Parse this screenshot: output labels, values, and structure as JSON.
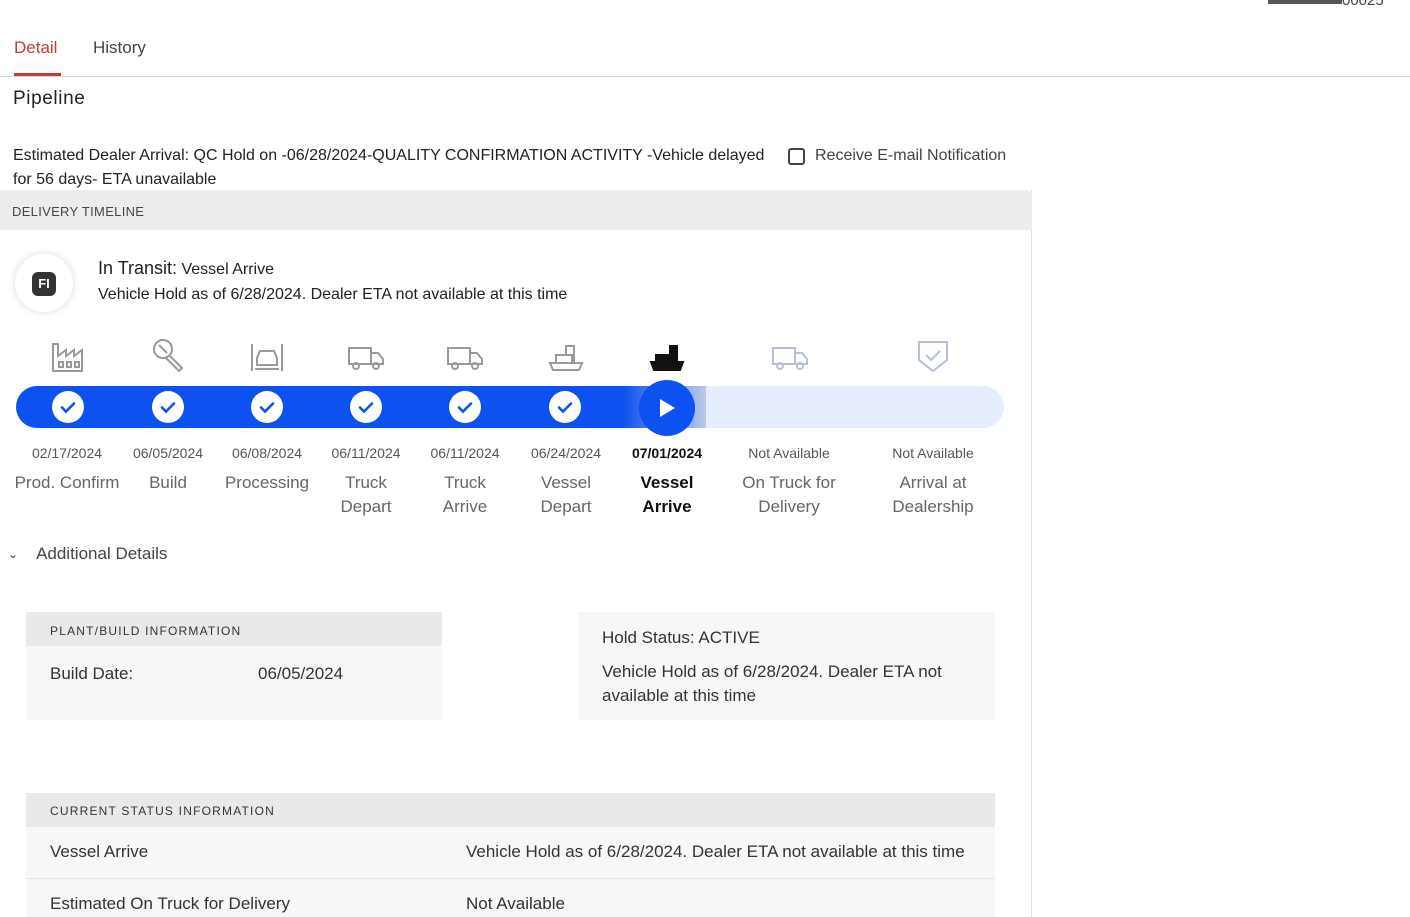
{
  "top": {
    "partial_text": "00025"
  },
  "tabs": [
    {
      "label": "Detail",
      "active": true
    },
    {
      "label": "History",
      "active": false
    }
  ],
  "section_title": "Pipeline",
  "eta": {
    "text": "Estimated Dealer Arrival: QC Hold on -06/28/2024-QUALITY CONFIRMATION ACTIVITY -Vehicle delayed for 56 days- ETA unavailable",
    "notify_label": "Receive E-mail Notification",
    "notify_checked": false
  },
  "timeline": {
    "header": "DELIVERY TIMELINE",
    "badge_text": "FI",
    "transit_label": "In Transit:",
    "transit_stage": "Vessel Arrive",
    "transit_message": "Vehicle Hold as of 6/28/2024. Dealer ETA not available at this time",
    "progress_color": "#0d52f0",
    "stages": [
      {
        "date": "02/17/2024",
        "name": "Prod. Confirm",
        "icon": "factory-icon",
        "status": "done"
      },
      {
        "date": "06/05/2024",
        "name": "Build",
        "icon": "wrench-icon",
        "status": "done"
      },
      {
        "date": "06/08/2024",
        "name": "Processing",
        "icon": "car-lift-icon",
        "status": "done"
      },
      {
        "date": "06/11/2024",
        "name": "Truck Depart",
        "icon": "truck-icon",
        "status": "done"
      },
      {
        "date": "06/11/2024",
        "name": "Truck Arrive",
        "icon": "truck-icon",
        "status": "done"
      },
      {
        "date": "06/24/2024",
        "name": "Vessel Depart",
        "icon": "ship-icon",
        "status": "done"
      },
      {
        "date": "07/01/2024",
        "name": "Vessel Arrive",
        "icon": "ship-icon",
        "status": "current"
      },
      {
        "date": "Not Available",
        "name": "On Truck for Delivery",
        "icon": "truck-icon",
        "status": "pending"
      },
      {
        "date": "Not Available",
        "name": "Arrival at Dealership",
        "icon": "shield-check-icon",
        "status": "pending"
      }
    ]
  },
  "additional_details": {
    "label": "Additional Details",
    "plant": {
      "header": "PLANT/BUILD INFORMATION",
      "rows": [
        {
          "key": "Build Date:",
          "value": "06/05/2024"
        }
      ]
    },
    "hold": {
      "status": "Hold Status: ACTIVE",
      "message": "Vehicle Hold as of 6/28/2024. Dealer ETA not available at this time"
    },
    "current_status": {
      "header": "CURRENT STATUS INFORMATION",
      "rows": [
        {
          "key": "Vessel Arrive",
          "value": "Vehicle Hold as of 6/28/2024. Dealer ETA not available at this time"
        },
        {
          "key": "Estimated On Truck for Delivery",
          "value": "Not Available"
        }
      ]
    }
  }
}
